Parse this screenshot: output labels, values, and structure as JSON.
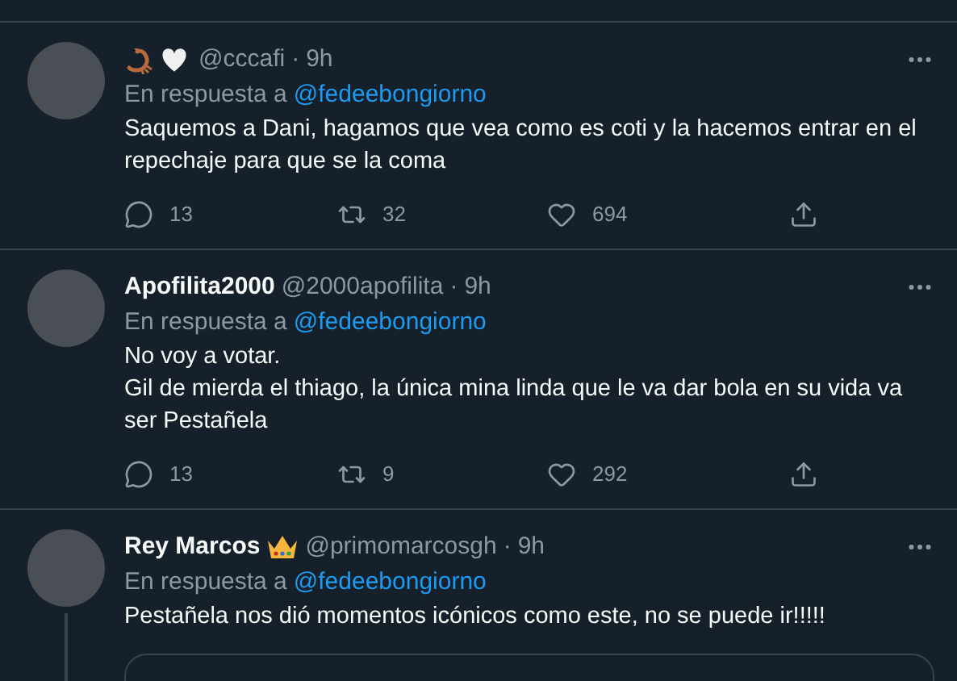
{
  "tweets": [
    {
      "badges": [
        {
          "kind": "scorpion"
        },
        {
          "kind": "heart"
        }
      ],
      "handle": "@cccafi",
      "separator": "·",
      "time": "9h",
      "reply_label": "En respuesta a",
      "reply_to": "@fedeebongiorno",
      "paragraphs": [
        "Saquemos a Dani, hagamos que vea como es coti y la hacemos entrar en el repechaje para que se la coma"
      ],
      "replies": "13",
      "retweets": "32",
      "likes": "694"
    },
    {
      "name": "Apofilita2000",
      "handle": "@2000apofilita",
      "separator": "·",
      "time": "9h",
      "reply_label": "En respuesta a",
      "reply_to": "@fedeebongiorno",
      "paragraphs": [
        "No voy a votar.",
        "Gil de mierda el thiago, la única mina linda que le va dar bola en su vida va ser Pestañela"
      ],
      "replies": "13",
      "retweets": "9",
      "likes": "292"
    },
    {
      "name": "Rey Marcos",
      "badges": [
        {
          "kind": "crown"
        }
      ],
      "handle": "@primomarcosgh",
      "separator": "·",
      "time": "9h",
      "reply_label": "En respuesta a",
      "reply_to": "@fedeebongiorno",
      "paragraphs": [
        "Pestañela nos dió momentos icónicos como este, no se puede ir!!!!!"
      ],
      "thread": true,
      "quote": true
    }
  ]
}
